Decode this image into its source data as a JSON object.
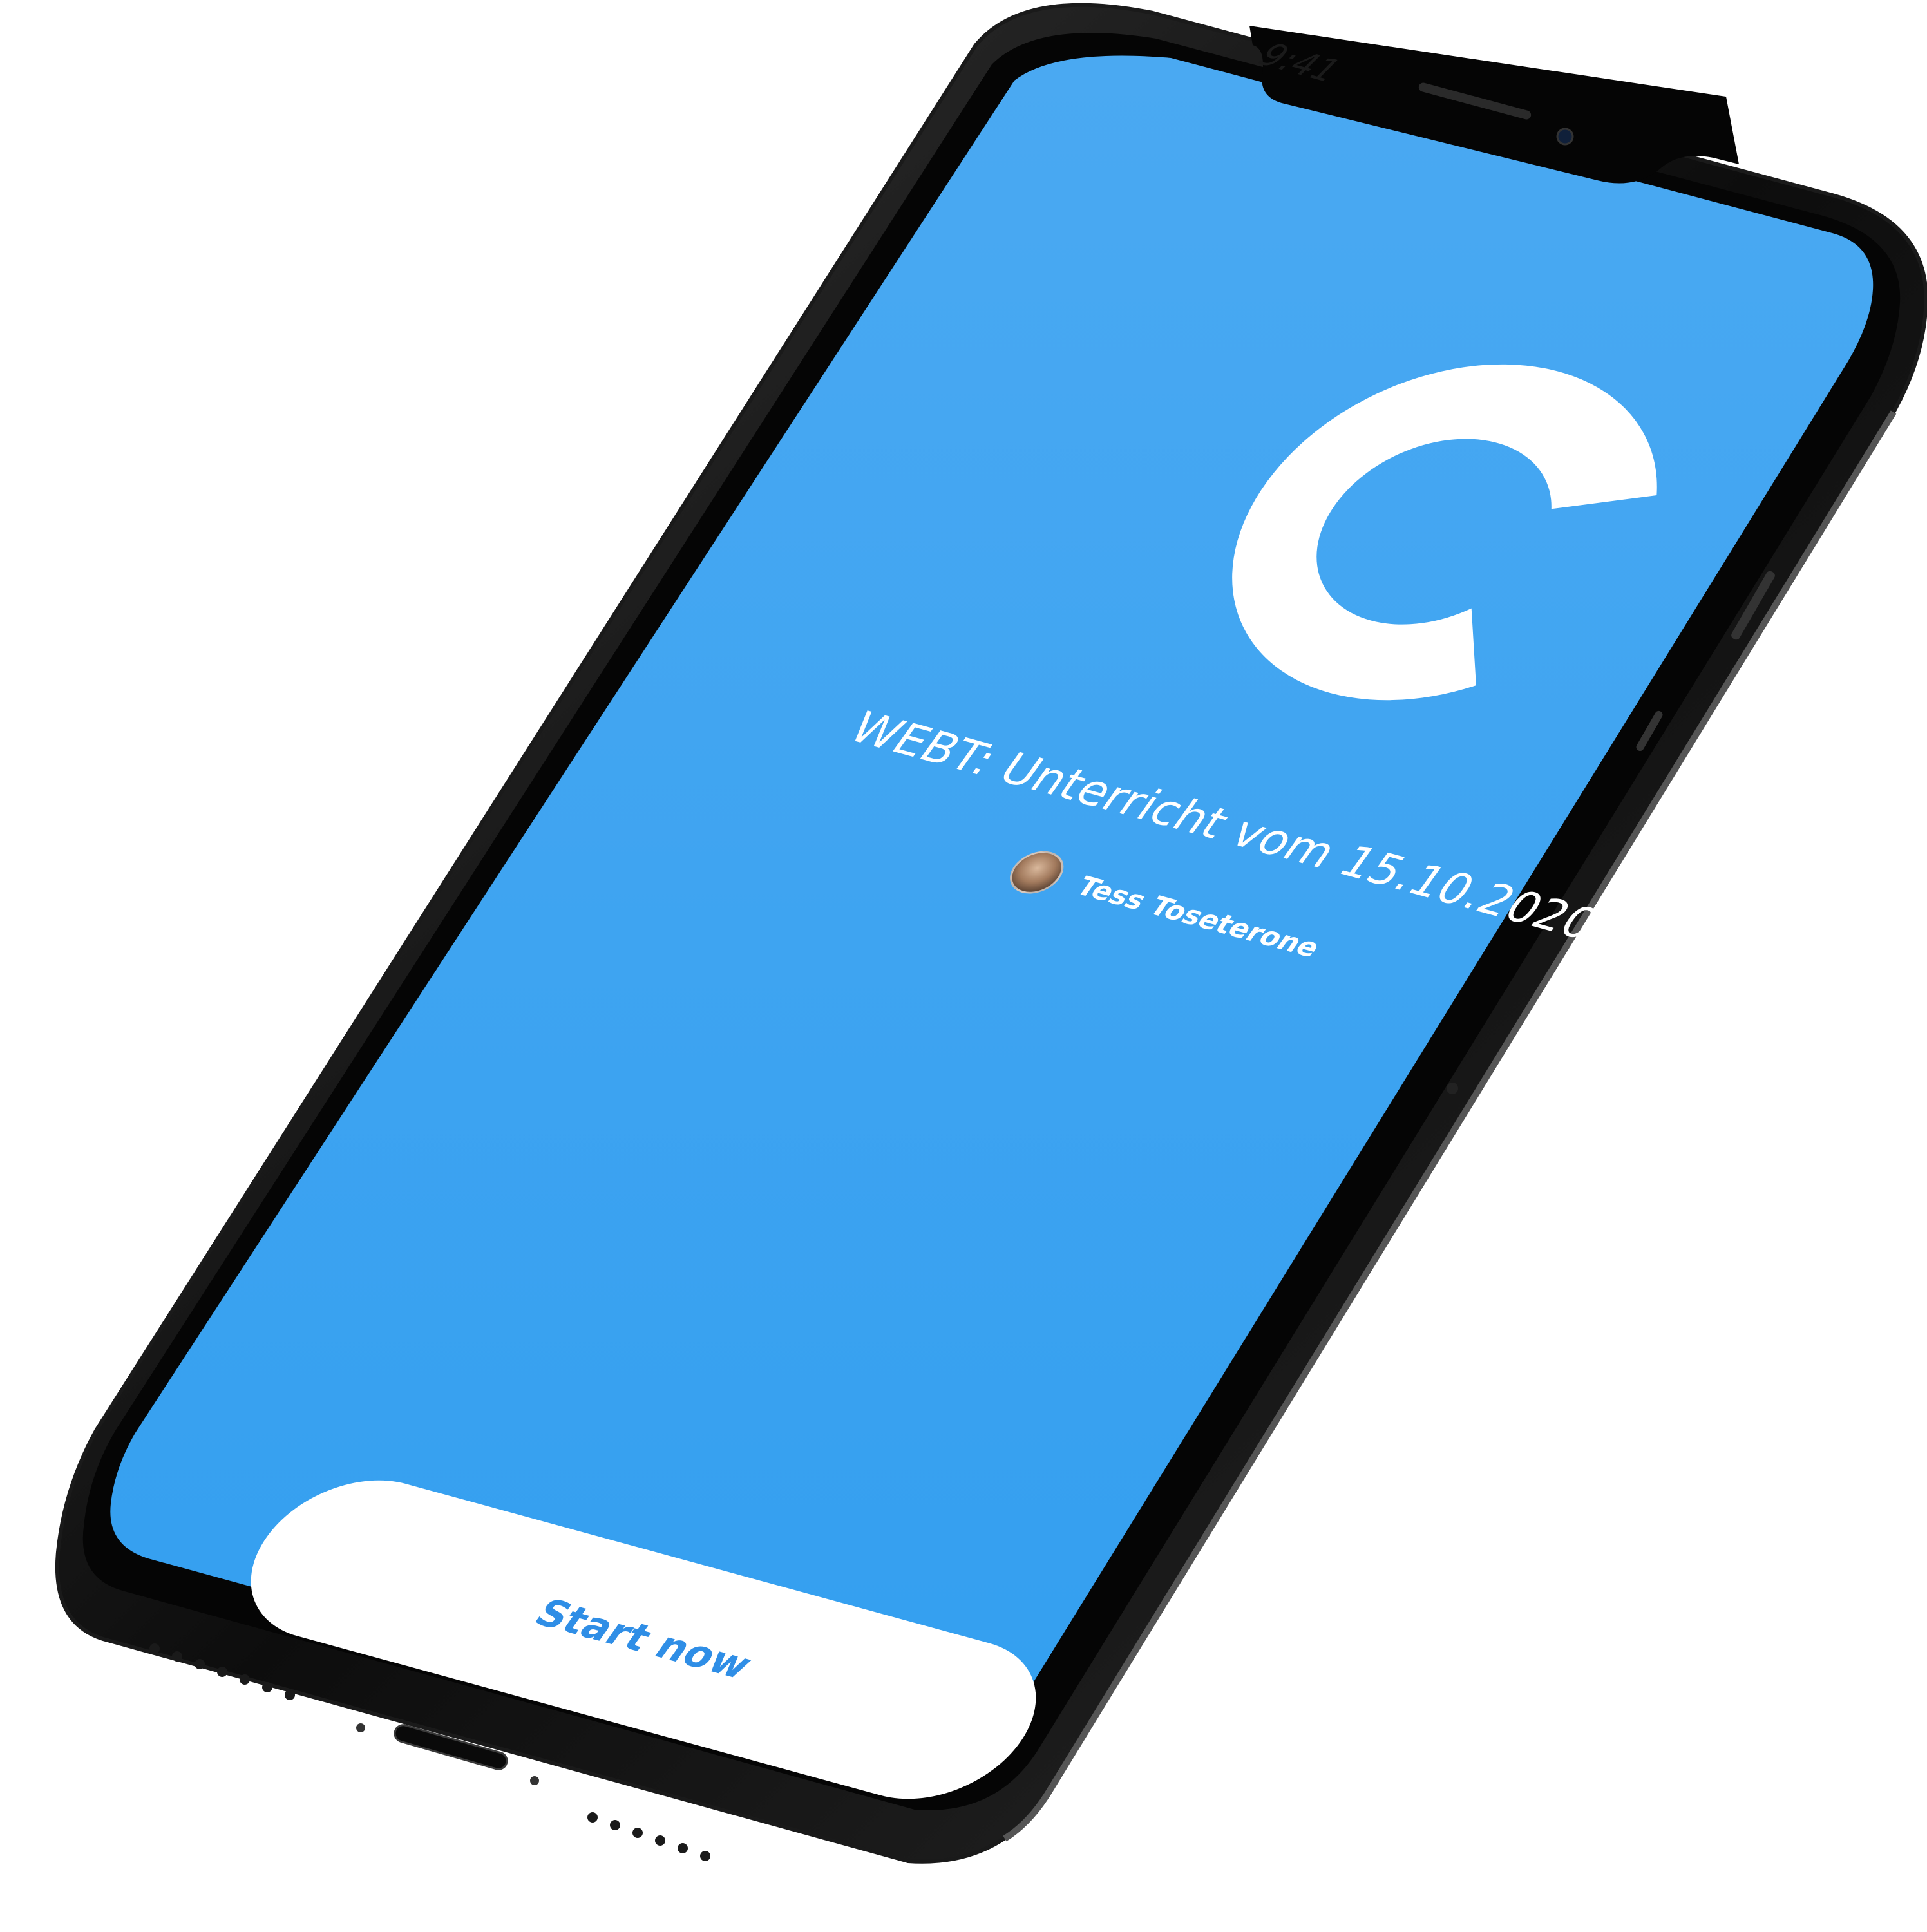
{
  "status_bar": {
    "time": "9:41"
  },
  "app": {
    "logo_icon": "c-logo-icon",
    "accent_color": "#3fa3ef",
    "title": "WEBT: Unterricht vom 15.10.2020",
    "author": {
      "name": "Tess Toseterone",
      "avatar_icon": "user-avatar-icon"
    },
    "start_button_label": "Start now"
  }
}
